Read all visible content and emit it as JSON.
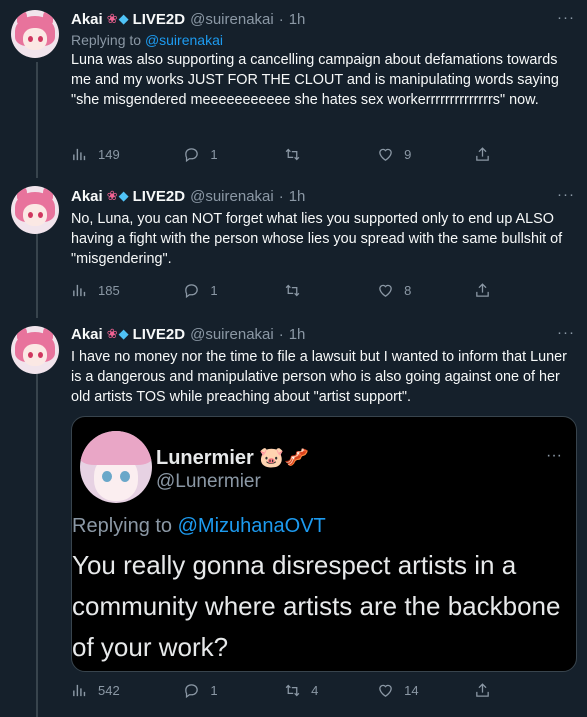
{
  "tweets": [
    {
      "author": "Akai",
      "badge": "LIVE2D",
      "handle": "@suirenakai",
      "separator": "·",
      "time": "1h",
      "replying_prefix": "Replying to",
      "replying_to": "@suirenakai",
      "text": "Luna was also supporting a cancelling campaign about defamations towards me and my works JUST FOR THE CLOUT and is manipulating words saying \"she misgendered meeeeeeeeeee she hates sex workerrrrrrrrrrrrrrs\" now.",
      "views": "149",
      "replies": "1",
      "retweets": "",
      "likes": "9"
    },
    {
      "author": "Akai",
      "badge": "LIVE2D",
      "handle": "@suirenakai",
      "separator": "·",
      "time": "1h",
      "text": "No, Luna, you can NOT forget what lies you supported only to end up ALSO having a fight with the person whose lies you spread with the same bullshit of \"misgendering\".",
      "views": "185",
      "replies": "1",
      "retweets": "",
      "likes": "8"
    },
    {
      "author": "Akai",
      "badge": "LIVE2D",
      "handle": "@suirenakai",
      "separator": "·",
      "time": "1h",
      "text": "I have no money nor the time to file a lawsuit but I wanted to inform that Luner is a dangerous and manipulative person who is also going against one of her old artists TOS while preaching about \"artist support\".",
      "views": "542",
      "replies": "1",
      "retweets": "4",
      "likes": "14"
    }
  ],
  "quoted": {
    "name": "Lunermier",
    "name_emoji": "🐷🥓",
    "handle": "@Lunermier",
    "replying_prefix": "Replying to",
    "replying_to": "@MizuhanaOVT",
    "text": "You really gonna disrespect artists in a community where artists are the backbone of your work?"
  },
  "icons": {
    "more": "more-dots-icon",
    "views": "views-bars-icon",
    "reply": "reply-bubble-icon",
    "retweet": "retweet-icon",
    "like": "heart-icon",
    "share": "share-icon",
    "lotus": "lotus-emoji",
    "gem": "gem-emoji"
  },
  "colors": {
    "background": "#15202b",
    "accent": "#1d9bf0",
    "secondary_text": "#8b98a5"
  }
}
